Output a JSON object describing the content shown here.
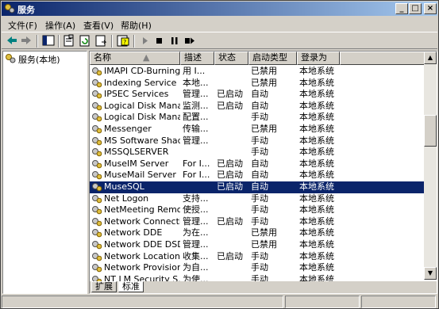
{
  "window": {
    "title": "服务"
  },
  "menu": [
    {
      "label": "文件(F)"
    },
    {
      "label": "操作(A)"
    },
    {
      "label": "查看(V)"
    },
    {
      "label": "帮助(H)"
    }
  ],
  "toolbar": [
    {
      "icon": "back-arrow-icon"
    },
    {
      "icon": "forward-arrow-icon"
    },
    {
      "icon": "show-hide-tree-icon"
    },
    {
      "icon": "properties-icon"
    },
    {
      "icon": "refresh-icon"
    },
    {
      "icon": "export-list-icon"
    },
    {
      "icon": "help-icon"
    },
    {
      "icon": "start-service-icon"
    },
    {
      "icon": "stop-service-icon"
    },
    {
      "icon": "pause-service-icon"
    },
    {
      "icon": "restart-service-icon"
    }
  ],
  "tree": {
    "root_label": "服务(本地)"
  },
  "columns": [
    "名称",
    "描述",
    "状态",
    "启动类型",
    "登录为"
  ],
  "services": [
    {
      "name": "IMAPI CD-Burning C...",
      "desc": "用 I...",
      "status": "",
      "startup": "已禁用",
      "logon": "本地系统"
    },
    {
      "name": "Indexing Service",
      "desc": "本地...",
      "status": "",
      "startup": "已禁用",
      "logon": "本地系统"
    },
    {
      "name": "IPSEC Services",
      "desc": "管理...",
      "status": "已启动",
      "startup": "自动",
      "logon": "本地系统"
    },
    {
      "name": "Logical Disk Manager",
      "desc": "监测...",
      "status": "已启动",
      "startup": "自动",
      "logon": "本地系统"
    },
    {
      "name": "Logical Disk Manage...",
      "desc": "配置...",
      "status": "",
      "startup": "手动",
      "logon": "本地系统"
    },
    {
      "name": "Messenger",
      "desc": "传输...",
      "status": "",
      "startup": "已禁用",
      "logon": "本地系统"
    },
    {
      "name": "MS Software Shado...",
      "desc": "管理...",
      "status": "",
      "startup": "手动",
      "logon": "本地系统"
    },
    {
      "name": "MSSQLSERVER",
      "desc": "",
      "status": "",
      "startup": "手动",
      "logon": "本地系统"
    },
    {
      "name": "MuseIM Server",
      "desc": "For I...",
      "status": "已启动",
      "startup": "自动",
      "logon": "本地系统"
    },
    {
      "name": "MuseMail Server",
      "desc": "For I...",
      "status": "已启动",
      "startup": "自动",
      "logon": "本地系统"
    },
    {
      "name": "MuseSQL",
      "desc": "",
      "status": "已启动",
      "startup": "自动",
      "logon": "本地系统",
      "selected": true
    },
    {
      "name": "Net Logon",
      "desc": "支持...",
      "status": "",
      "startup": "手动",
      "logon": "本地系统"
    },
    {
      "name": "NetMeeting Remote...",
      "desc": "使授...",
      "status": "",
      "startup": "手动",
      "logon": "本地系统"
    },
    {
      "name": "Network Connections",
      "desc": "管理...",
      "status": "已启动",
      "startup": "手动",
      "logon": "本地系统"
    },
    {
      "name": "Network DDE",
      "desc": "为在...",
      "status": "",
      "startup": "已禁用",
      "logon": "本地系统"
    },
    {
      "name": "Network DDE DSDM",
      "desc": "管理...",
      "status": "",
      "startup": "已禁用",
      "logon": "本地系统"
    },
    {
      "name": "Network Location A...",
      "desc": "收集...",
      "status": "已启动",
      "startup": "手动",
      "logon": "本地系统"
    },
    {
      "name": "Network Provisionin...",
      "desc": "为自...",
      "status": "",
      "startup": "手动",
      "logon": "本地系统"
    },
    {
      "name": "NT LM Security S...",
      "desc": "为使...",
      "status": "",
      "startup": "手动",
      "logon": "本地系统"
    }
  ],
  "tabs": [
    "扩展",
    "标准"
  ],
  "colors": {
    "title_start": "#0a246a",
    "title_end": "#a6caf0",
    "selection": "#0a246a",
    "face": "#d4d0c8"
  }
}
